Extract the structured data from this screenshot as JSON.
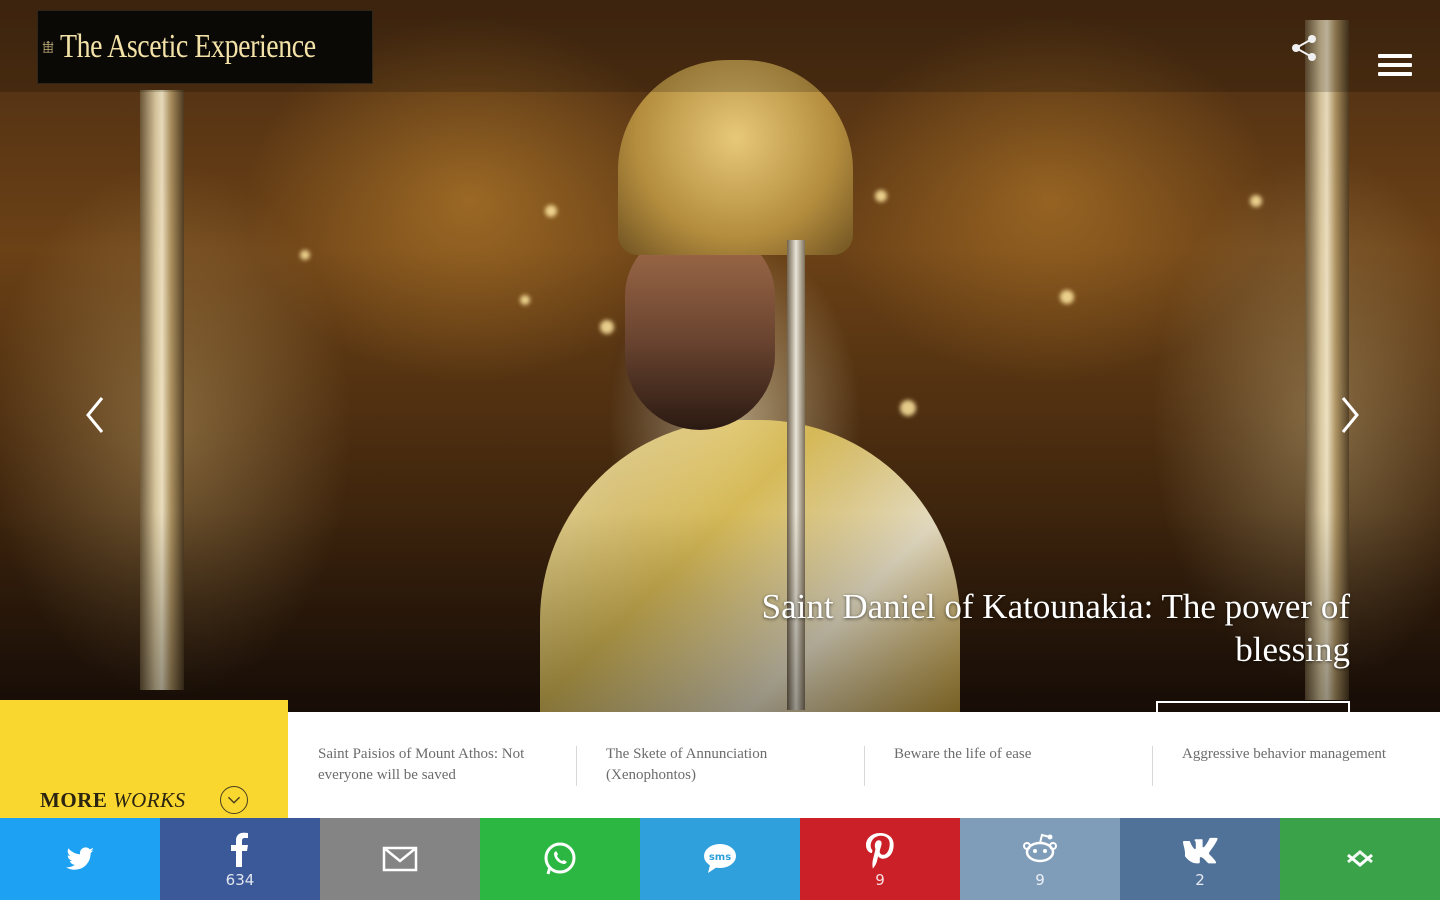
{
  "site": {
    "logo_text": "The Ascetic Experience"
  },
  "hero": {
    "headline": "Saint Daniel of Katounakia: The power of blessing"
  },
  "more_works": {
    "label_bold": "MORE",
    "label_italic": "WORKS"
  },
  "related": [
    {
      "title": "Saint Paisios of Mount Athos: Not everyone will be saved"
    },
    {
      "title": "The Skete of Annunciation (Xenophontos)"
    },
    {
      "title": "Beware the life of ease"
    },
    {
      "title": "Aggressive behavior management"
    }
  ],
  "share_bar": [
    {
      "name": "twitter",
      "icon": "twitter-icon",
      "color": "#1da1f2",
      "count": ""
    },
    {
      "name": "facebook",
      "icon": "facebook-icon",
      "color": "#3b5998",
      "count": "634"
    },
    {
      "name": "email",
      "icon": "email-icon",
      "color": "#848484",
      "count": ""
    },
    {
      "name": "whatsapp",
      "icon": "whatsapp-icon",
      "color": "#2cb742",
      "count": ""
    },
    {
      "name": "sms",
      "icon": "sms-icon",
      "color": "#2fa0dc",
      "count": ""
    },
    {
      "name": "pinterest",
      "icon": "pinterest-icon",
      "color": "#cb2027",
      "count": "9"
    },
    {
      "name": "reddit",
      "icon": "reddit-icon",
      "color": "#7f9db9",
      "count": "9"
    },
    {
      "name": "vk",
      "icon": "vk-icon",
      "color": "#507299",
      "count": "2"
    },
    {
      "name": "more",
      "icon": "more-share-icon",
      "color": "#3aa34a",
      "count": ""
    }
  ]
}
